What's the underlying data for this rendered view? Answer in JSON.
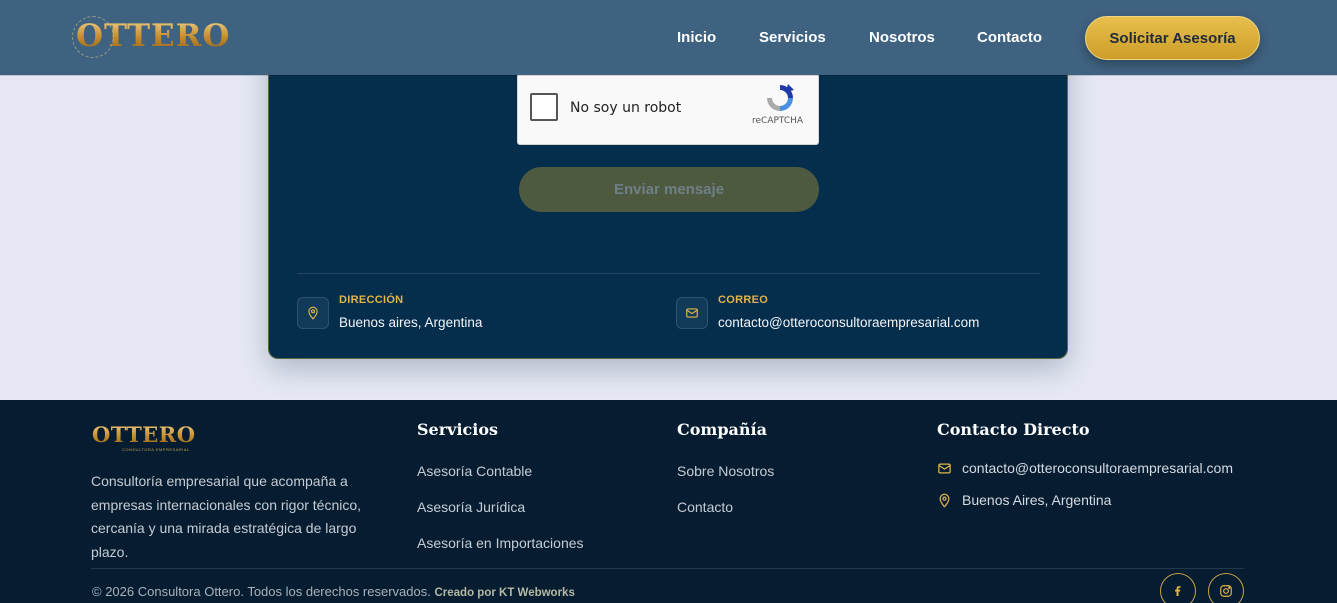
{
  "brand": {
    "name": "OTTERO",
    "tagline": "CONSULTORA EMPRESARIAL"
  },
  "nav": {
    "items": [
      "Inicio",
      "Servicios",
      "Nosotros",
      "Contacto"
    ],
    "cta": "Solicitar Asesoría"
  },
  "form": {
    "recaptcha_label": "No soy un robot",
    "recaptcha_brand": "reCAPTCHA",
    "submit_label": "Enviar mensaje"
  },
  "contact_info": {
    "address_label": "DIRECCIÓN",
    "address_value": "Buenos aires, Argentina",
    "email_label": "CORREO",
    "email_value": "contacto@otteroconsultoraempresarial.com"
  },
  "footer": {
    "description": "Consultoría empresarial que acompaña a empresas internacionales con rigor técnico, cercanía y una mirada estratégica de largo plazo.",
    "servicios": {
      "title": "Servicios",
      "links": [
        "Asesoría Contable",
        "Asesoría Jurídica",
        "Asesoría en Importaciones"
      ]
    },
    "compania": {
      "title": "Compañía",
      "links": [
        "Sobre Nosotros",
        "Contacto"
      ]
    },
    "contacto": {
      "title": "Contacto Directo",
      "email": "contacto@otteroconsultoraempresarial.com",
      "location": "Buenos Aires, Argentina"
    },
    "copyright": "© 2026 Consultora Ottero. Todos los derechos reservados.",
    "credit": "Creado por KT Webworks",
    "social_icons": [
      "facebook-icon",
      "instagram-icon"
    ]
  },
  "colors": {
    "header_bg": "#3f6280",
    "card_bg": "#052d4c",
    "footer_bg": "#061c30",
    "accent_gold": "#e0b44a",
    "page_bg": "#e6e9f5"
  }
}
